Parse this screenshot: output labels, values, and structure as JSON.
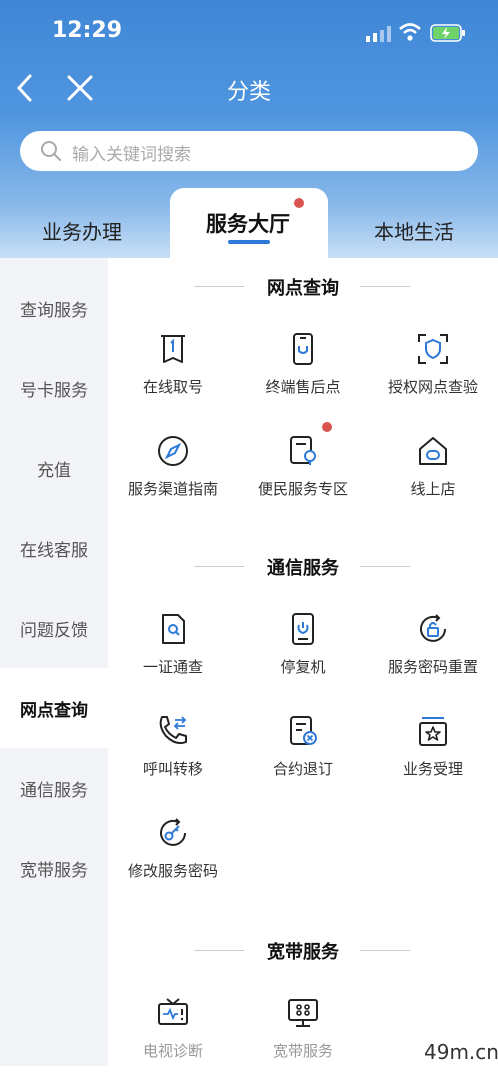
{
  "status": {
    "time": "12:29"
  },
  "nav": {
    "title": "分类"
  },
  "search": {
    "placeholder": "输入关键词搜索"
  },
  "tabs": [
    {
      "label": "业务办理"
    },
    {
      "label": "服务大厅"
    },
    {
      "label": "本地生活"
    }
  ],
  "sidebar": {
    "items": [
      {
        "label": "查询服务"
      },
      {
        "label": "号卡服务"
      },
      {
        "label": "充值"
      },
      {
        "label": "在线客服"
      },
      {
        "label": "问题反馈"
      },
      {
        "label": "网点查询"
      },
      {
        "label": "通信服务"
      },
      {
        "label": "宽带服务"
      }
    ]
  },
  "sections": [
    {
      "title": "网点查询",
      "items": [
        {
          "label": "在线取号",
          "icon": "queue-ticket-icon"
        },
        {
          "label": "终端售后点",
          "icon": "phone-service-icon"
        },
        {
          "label": "授权网点查验",
          "icon": "shield-scan-icon"
        },
        {
          "label": "服务渠道指南",
          "icon": "compass-icon"
        },
        {
          "label": "便民服务专区",
          "icon": "service-zone-icon"
        },
        {
          "label": "线上店",
          "icon": "store-icon"
        }
      ]
    },
    {
      "title": "通信服务",
      "items": [
        {
          "label": "一证通查",
          "icon": "id-search-icon"
        },
        {
          "label": "停复机",
          "icon": "phone-power-icon"
        },
        {
          "label": "服务密码重置",
          "icon": "lock-reset-icon"
        },
        {
          "label": "呼叫转移",
          "icon": "call-forward-icon"
        },
        {
          "label": "合约退订",
          "icon": "contract-cancel-icon"
        },
        {
          "label": "业务受理",
          "icon": "star-box-icon"
        },
        {
          "label": "修改服务密码",
          "icon": "key-icon"
        }
      ]
    },
    {
      "title": "宽带服务",
      "items": [
        {
          "label": "电视诊断",
          "icon": "tv-diagnose-icon"
        },
        {
          "label": "宽带服务",
          "icon": "broadband-icon"
        }
      ]
    }
  ],
  "watermark": "49m.cn",
  "colors": {
    "accent": "#2e7ad6",
    "badge": "#d9534f",
    "header": "#4a90dc"
  }
}
